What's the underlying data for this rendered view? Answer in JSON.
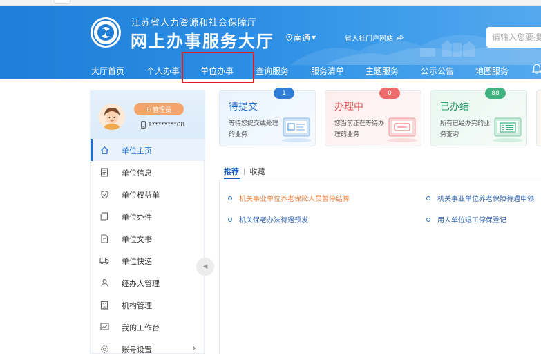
{
  "header": {
    "org_name": "江苏省人力资源和社会保障厅",
    "site_title": "网上办事服务大厅",
    "city": "南通",
    "portal_link": "省人社门户网站",
    "search_placeholder": "请输入您要搜"
  },
  "nav": {
    "items": [
      "大厅首页",
      "个人办事",
      "单位办事",
      "查询服务",
      "服务清单",
      "主题服务",
      "公示公告",
      "地图服务"
    ],
    "active": "单位办事"
  },
  "sidebar": {
    "role": "管理员",
    "phone": "1********08",
    "items": [
      {
        "label": "单位主页",
        "icon": "home-icon",
        "active": true
      },
      {
        "label": "单位信息",
        "icon": "document-icon"
      },
      {
        "label": "单位权益单",
        "icon": "shield-icon"
      },
      {
        "label": "单位办件",
        "icon": "files-icon"
      },
      {
        "label": "单位文书",
        "icon": "paper-icon"
      },
      {
        "label": "单位快递",
        "icon": "truck-icon"
      },
      {
        "label": "经办人管理",
        "icon": "users-icon"
      },
      {
        "label": "机构管理",
        "icon": "building-icon"
      },
      {
        "label": "我的工作台",
        "icon": "chart-icon"
      },
      {
        "label": "账号设置",
        "icon": "gear-icon",
        "chevron": "›"
      }
    ]
  },
  "cards": [
    {
      "title": "待提交",
      "desc": "等待您提交或处理的业务",
      "count": "1"
    },
    {
      "title": "办理中",
      "desc": "您当前正在等待办理的业务",
      "count": "0"
    },
    {
      "title": "已办结",
      "desc": "所有已经办完的业务查询",
      "count": "88"
    }
  ],
  "tabs": {
    "recommend": "推荐",
    "separator": "|",
    "favorites": "收藏"
  },
  "recommendations": [
    "机关事业单位养老保险人员暂停结算",
    "机关事业单位养老保险待遇申领",
    "机关保老办法待遇预发",
    "用人单位退工停保登记"
  ],
  "colors": {
    "banner_blue": "#2b8de3",
    "active_blue": "#1c6fcf",
    "highlight_orange": "#e8803a",
    "nav_highlight_box": "#e02020"
  }
}
